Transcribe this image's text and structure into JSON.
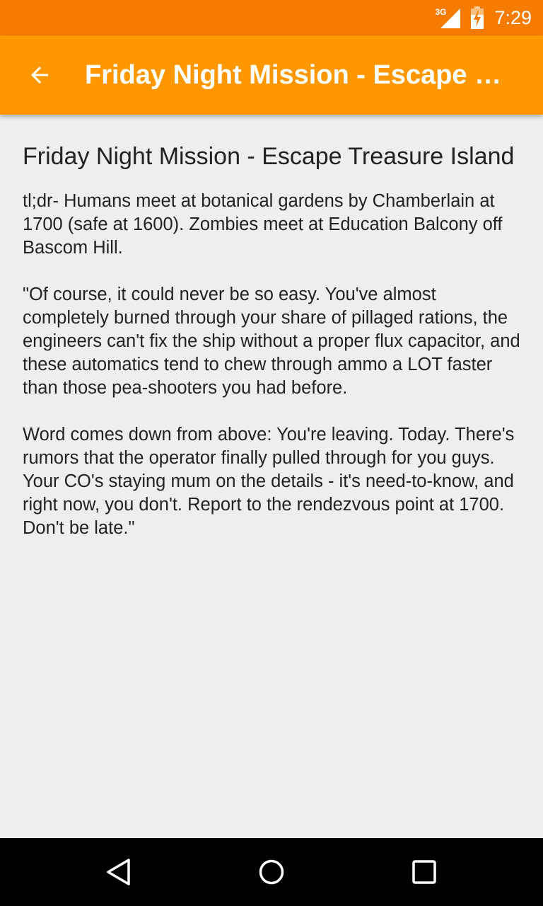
{
  "status_bar": {
    "network_type": "3G",
    "time": "7:29"
  },
  "app_bar": {
    "title": "Friday Night Mission - Escape Tr...",
    "color": "#ff9800"
  },
  "event": {
    "title": "Friday Night Mission - Escape Treasure Island",
    "paragraphs": [
      "tl;dr- Humans meet at botanical gardens by Chamberlain at 1700 (safe at 1600). Zombies meet at Education Balcony off Bascom Hill.",
      "\"Of course, it could never be so easy. You've almost completely burned through your share of pillaged rations, the engineers can't fix the ship without a proper flux capacitor, and these automatics tend to chew through ammo a LOT faster than those pea-shooters you had before.",
      "Word comes down from above: You're leaving. Today. There's rumors that the operator finally pulled through for you guys. Your CO's staying mum on the details - it's need-to-know, and right now, you don't. Report to the rendezvous point at 1700. Don't be late.\""
    ]
  },
  "icons": {
    "back": "arrow-back-icon",
    "signal": "cell-signal-icon",
    "battery": "battery-charging-icon",
    "nav_back": "nav-back-icon",
    "nav_home": "nav-home-icon",
    "nav_recents": "nav-recents-icon"
  },
  "colors": {
    "status_bar": "#f57c00",
    "app_bar": "#ff9800",
    "background": "#eeeeee",
    "nav_bar": "#000000"
  }
}
